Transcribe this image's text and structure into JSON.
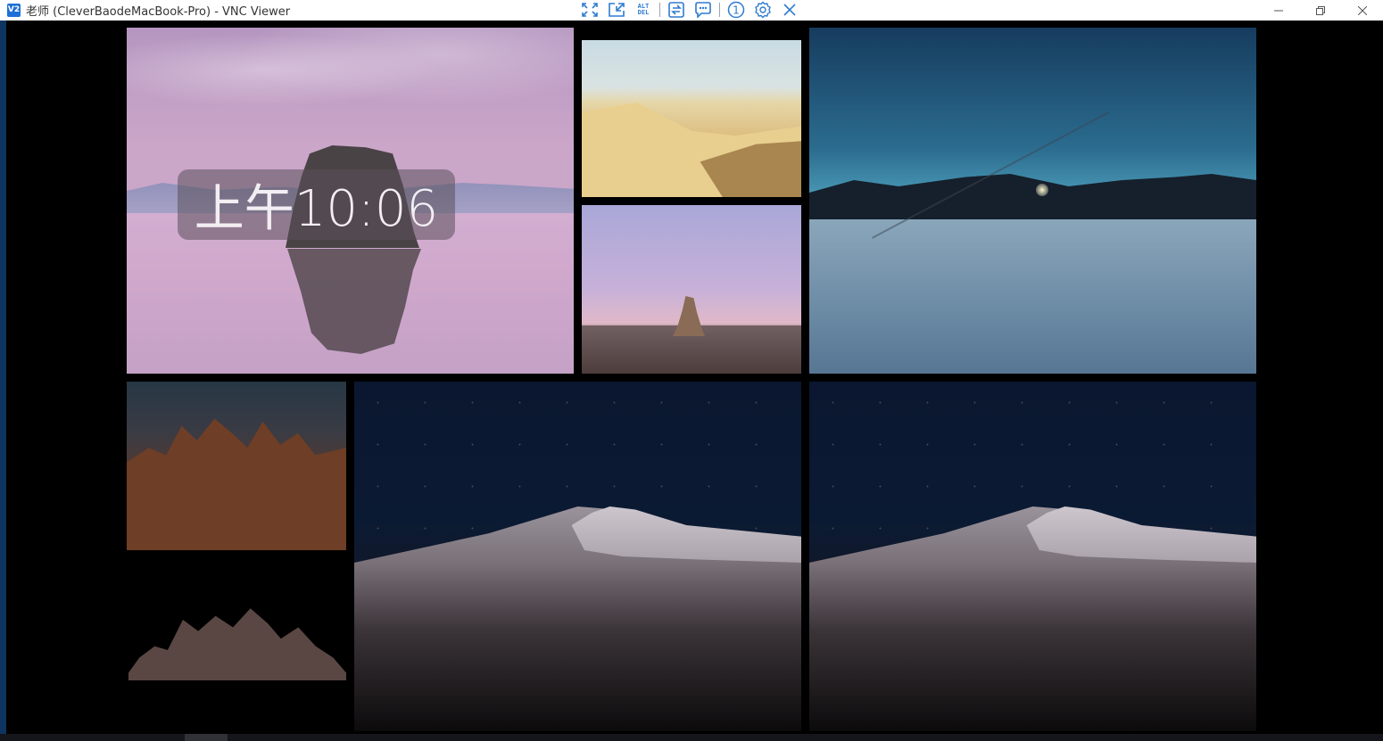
{
  "window": {
    "app_icon": "V2",
    "title": "老师 (CleverBaodeMacBook-Pro) - VNC Viewer",
    "controls": [
      "minimize-icon",
      "restore-icon",
      "close-icon"
    ]
  },
  "toolbar": {
    "buttons": [
      {
        "name": "fullscreen-icon"
      },
      {
        "name": "scale-icon"
      },
      {
        "name": "ctrl-alt-del",
        "label_top": "ALT",
        "label_bottom": "DEL"
      },
      {
        "name": "transfer-icon"
      },
      {
        "name": "chat-icon"
      },
      {
        "name": "info-icon",
        "label": "1"
      },
      {
        "name": "settings-icon"
      },
      {
        "name": "close-icon"
      }
    ],
    "accent_color": "#2e7bd0"
  },
  "remote_desktop": {
    "lock_clock": "上午10:06",
    "wallpapers": [
      "pink-lake-rock",
      "sand-dunes-day",
      "desert-spire",
      "blue-lake-bed",
      "red-rocks",
      "dark-tufa",
      "night-dunes",
      "night-dunes"
    ]
  },
  "colors": {
    "desktop_background": "#000000",
    "host_background": "#0d3560",
    "titlebar": "#ffffff"
  }
}
